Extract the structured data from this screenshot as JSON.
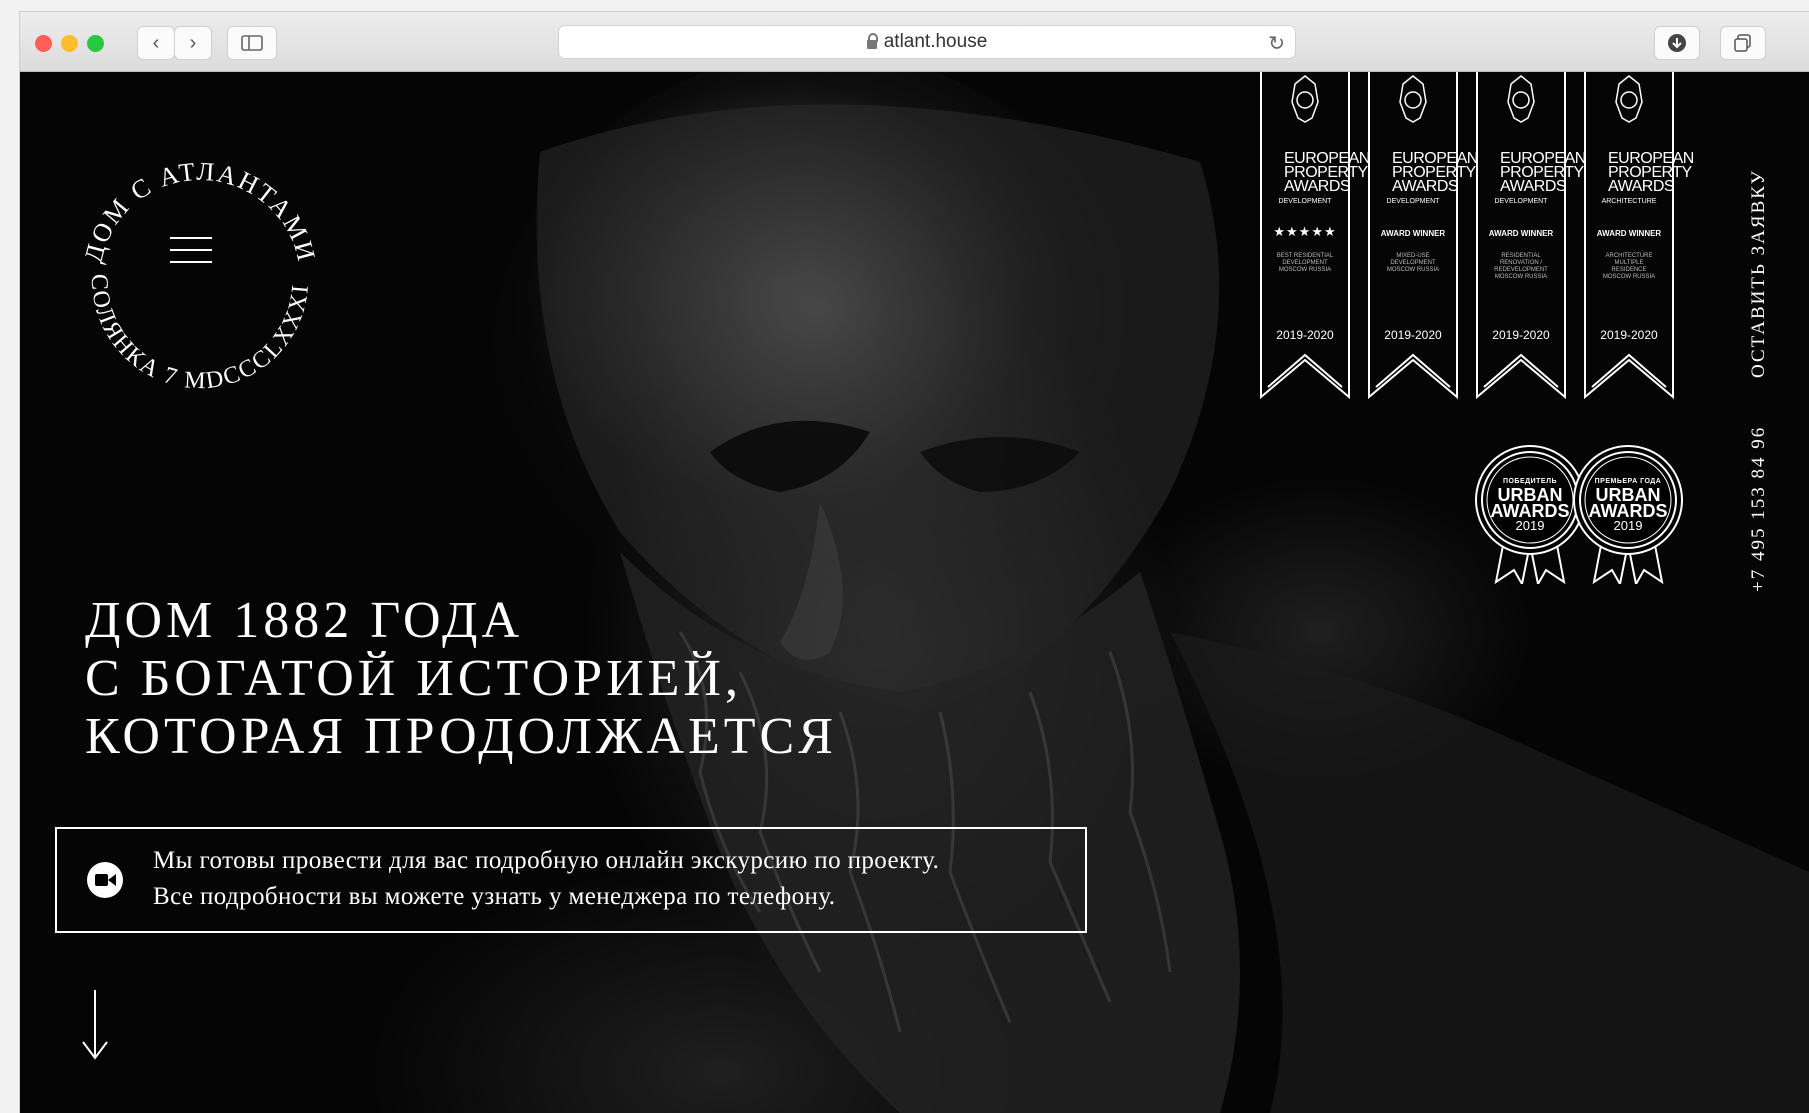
{
  "browser": {
    "url": "atlant.house",
    "back_icon": "‹",
    "forward_icon": "›"
  },
  "logo": {
    "top_text": "ДОМ С АТЛАНТАМИ",
    "bottom_text": "СОЛЯНКА 7 MDCCCLXXXII"
  },
  "hero": {
    "headline": [
      "ДОМ 1882 ГОДА",
      "С БОГАТОЙ ИСТОРИЕЙ,",
      "КОТОРАЯ ПРОДОЛЖАЕТСЯ"
    ]
  },
  "notice": {
    "line1": "Мы готовы провести для вас подробную онлайн экскурсию по проекту.",
    "line2": "Все подробности вы можете узнать у менеджера по телефону."
  },
  "side": {
    "request_label": "ОСТАВИТЬ ЗАЯВКУ",
    "phone": "+7 495 153 84 96"
  },
  "awards": {
    "ribbons": [
      {
        "title": "EUROPEAN PROPERTY AWARDS",
        "category": "DEVELOPMENT",
        "status": "★★★★★",
        "details": "BEST RESIDENTIAL DEVELOPMENT MOSCOW RUSSIA",
        "year": "2019-2020"
      },
      {
        "title": "EUROPEAN PROPERTY AWARDS",
        "category": "DEVELOPMENT",
        "status": "AWARD WINNER",
        "details": "MIXED-USE DEVELOPMENT MOSCOW RUSSIA",
        "year": "2019-2020"
      },
      {
        "title": "EUROPEAN PROPERTY AWARDS",
        "category": "DEVELOPMENT",
        "status": "AWARD WINNER",
        "details": "RESIDENTIAL RENOVATION / REDEVELOPMENT MOSCOW RUSSIA",
        "year": "2019-2020"
      },
      {
        "title": "EUROPEAN PROPERTY AWARDS",
        "category": "ARCHITECTURE",
        "status": "AWARD WINNER",
        "details": "ARCHITECTURE MULTIPLE RESIDENCE MOSCOW RUSSIA",
        "year": "2019-2020"
      }
    ],
    "medals": [
      {
        "label": "ПОБЕДИТЕЛЬ",
        "name": "URBAN AWARDS",
        "year": "2019"
      },
      {
        "label": "ПРЕМЬЕРА ГОДА",
        "name": "URBAN AWARDS",
        "year": "2019"
      }
    ]
  },
  "colors": {
    "background": "#000000",
    "text": "#ffffff",
    "close": "#fe5f57",
    "minimize": "#febc2e",
    "zoom": "#28c840"
  }
}
